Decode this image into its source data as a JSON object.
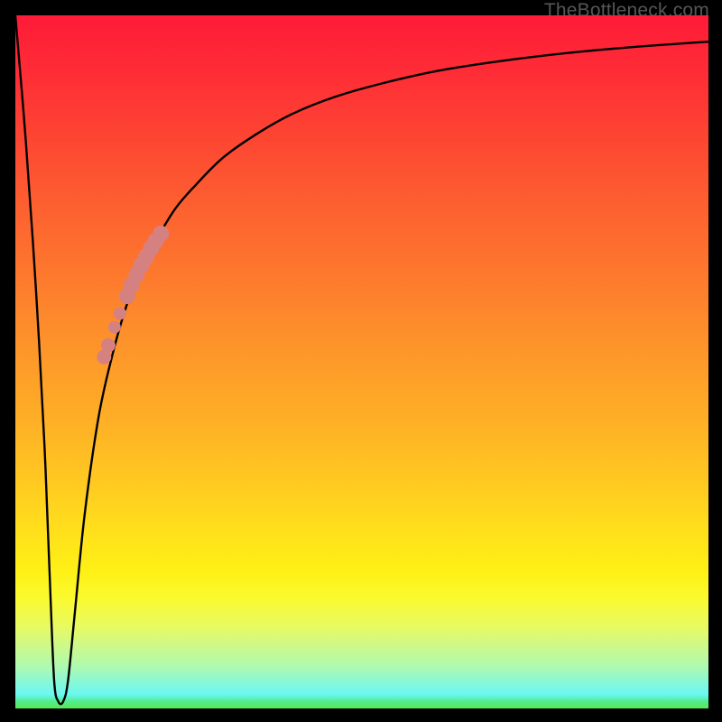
{
  "watermark": "TheBottleneck.com",
  "colors": {
    "frame": "#000000",
    "curve_stroke": "#000000",
    "marker_fill": "#d68181",
    "marker_stroke": "#c97676"
  },
  "chart_data": {
    "type": "line",
    "title": "",
    "xlabel": "",
    "ylabel": "",
    "xlim": [
      0,
      100
    ],
    "ylim": [
      0,
      100
    ],
    "x_is_normalized_fraction_of_plot_width": true,
    "y_is_percent_from_top": true,
    "note": "Curve shows bottleneck percentage. Dips to ~0 near x≈6, rises asymptotically toward ~100 by right edge.",
    "series": [
      {
        "name": "bottleneck-curve",
        "x": [
          0,
          1.5,
          3.0,
          4.2,
          5.0,
          5.6,
          6.2,
          6.9,
          7.6,
          8.6,
          10,
          12,
          14,
          16,
          18,
          20,
          23,
          26,
          30,
          35,
          40,
          46,
          53,
          61,
          70,
          80,
          90,
          100
        ],
        "y": [
          100,
          82,
          60,
          38,
          18,
          4,
          1,
          1,
          4,
          14,
          28,
          42,
          51,
          58,
          63,
          67,
          72,
          75.5,
          79.5,
          83,
          85.8,
          88.2,
          90.2,
          92,
          93.4,
          94.6,
          95.5,
          96.2
        ]
      }
    ],
    "markers": [
      {
        "name": "cluster-main-top",
        "x": 21.0,
        "y": 68.5,
        "r": 9
      },
      {
        "name": "cluster-main-2",
        "x": 20.3,
        "y": 67.5,
        "r": 9
      },
      {
        "name": "cluster-main-3",
        "x": 19.6,
        "y": 66.4,
        "r": 9
      },
      {
        "name": "cluster-main-4",
        "x": 18.9,
        "y": 65.2,
        "r": 9
      },
      {
        "name": "cluster-main-5",
        "x": 18.2,
        "y": 64.0,
        "r": 9
      },
      {
        "name": "cluster-main-6",
        "x": 17.5,
        "y": 62.6,
        "r": 9
      },
      {
        "name": "cluster-main-7",
        "x": 16.8,
        "y": 61.1,
        "r": 9
      },
      {
        "name": "cluster-main-bottom",
        "x": 16.1,
        "y": 59.5,
        "r": 9
      },
      {
        "name": "dot-mid-a",
        "x": 15.1,
        "y": 57.0,
        "r": 7
      },
      {
        "name": "dot-mid-b",
        "x": 14.3,
        "y": 55.0,
        "r": 7
      },
      {
        "name": "dot-low-a",
        "x": 13.4,
        "y": 52.4,
        "r": 8
      },
      {
        "name": "dot-low-b",
        "x": 12.8,
        "y": 50.7,
        "r": 8
      }
    ]
  }
}
